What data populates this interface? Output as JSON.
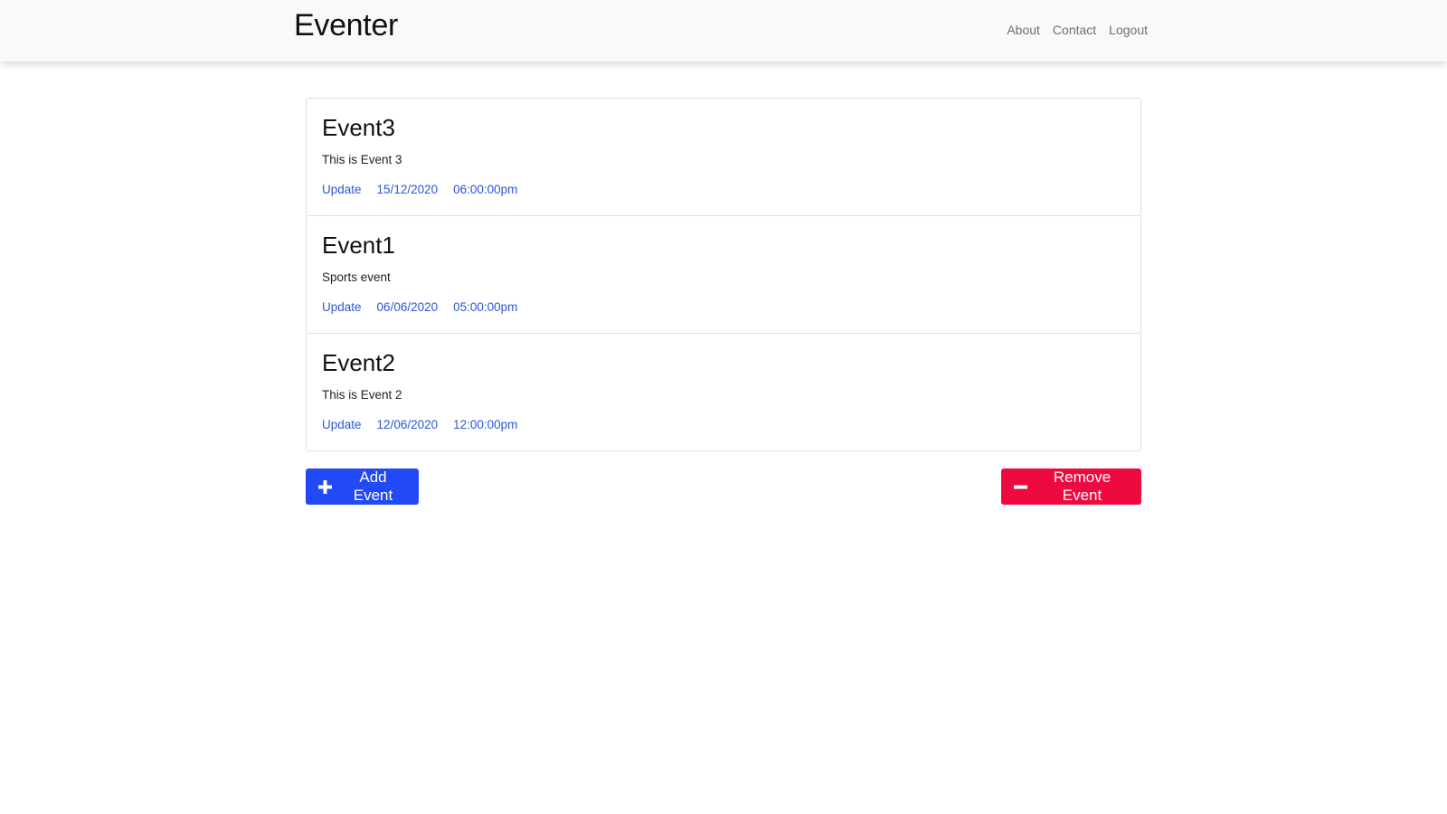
{
  "navbar": {
    "brand": "Eventer",
    "links": [
      "About",
      "Contact",
      "Logout"
    ]
  },
  "events": [
    {
      "title": "Event3",
      "description": "This is Event 3",
      "update_label": "Update",
      "date": "15/12/2020",
      "time": "06:00:00pm"
    },
    {
      "title": "Event1",
      "description": "Sports event",
      "update_label": "Update",
      "date": "06/06/2020",
      "time": "05:00:00pm"
    },
    {
      "title": "Event2",
      "description": "This is Event 2",
      "update_label": "Update",
      "date": "12/06/2020",
      "time": "12:00:00pm"
    }
  ],
  "actions": {
    "add_label": "Add Event",
    "add_icon": "plus-icon",
    "add_color": "#2149f5",
    "remove_label": "Remove Event",
    "remove_icon": "minus-icon",
    "remove_color": "#ee0a3f"
  }
}
